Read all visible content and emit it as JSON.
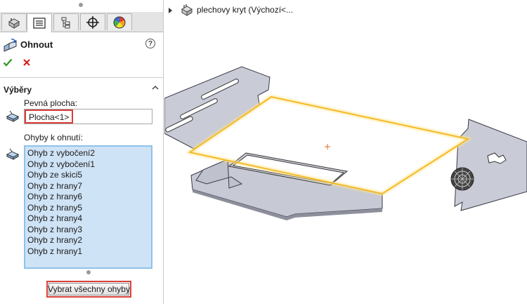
{
  "panel": {
    "tabs": [
      {
        "name": "feature-manager",
        "icon": "feature-tree-icon"
      },
      {
        "name": "property-manager",
        "icon": "property-manager-icon",
        "active": true
      },
      {
        "name": "configuration-manager",
        "icon": "configuration-icon"
      },
      {
        "name": "dimxpert-manager",
        "icon": "crosshair-icon"
      },
      {
        "name": "display-manager",
        "icon": "color-wheel-icon"
      }
    ],
    "feature_title": "Ohnout",
    "help_label": "?",
    "ok_label": "✔",
    "cancel_label": "✕",
    "section_title": "Výběry",
    "fixed_face_label": "Pevná plocha:",
    "fixed_face_value": "Plocha<1>",
    "bends_label": "Ohyby k ohnutí:",
    "bends": [
      "Ohyb z vybočení2",
      "Ohyb z vybočení1",
      "Ohyb ze skici5",
      "Ohyb z hrany7",
      "Ohyb z hrany6",
      "Ohyb z hrany5",
      "Ohyb z hrany4",
      "Ohyb z hrany3",
      "Ohyb z hrany2",
      "Ohyb z hrany1"
    ],
    "select_all_label": "Vybrat všechny ohyby"
  },
  "tree": {
    "part_label": "plechovy kryt  (Výchozí<..."
  },
  "colors": {
    "highlight_red": "#d9403a",
    "list_bg": "#cfe3f6",
    "list_border": "#8ec2ec",
    "selection_edge": "#f2b31b",
    "ok_green": "#3a9a2e",
    "cancel_red": "#d21f1f"
  }
}
